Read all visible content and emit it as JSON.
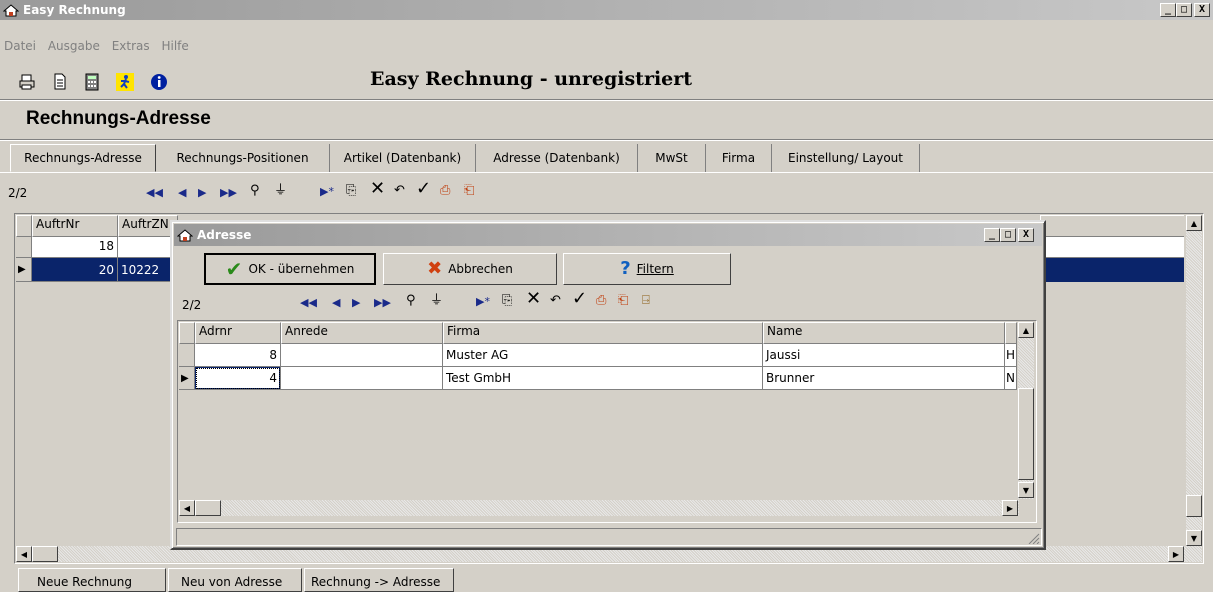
{
  "window": {
    "title": "Easy Rechnung",
    "controls": [
      "_",
      "□",
      "X"
    ]
  },
  "menu": [
    "Datei",
    "Ausgabe",
    "Extras",
    "Hilfe"
  ],
  "banner": "Easy Rechnung - unregistriert",
  "section_title": "Rechnungs-Adresse",
  "tabs": [
    "Rechnungs-Adresse",
    "Rechnungs-Positionen",
    "Artikel (Datenbank)",
    "Adresse (Datenbank)",
    "MwSt",
    "Firma",
    "Einstellung/ Layout"
  ],
  "main_nav": {
    "record_counter": "2/2"
  },
  "main_grid": {
    "columns": [
      "AuftrNr",
      "AuftrZN"
    ],
    "rows": [
      {
        "auftrnr": "18",
        "auftrzn": ""
      },
      {
        "auftrnr": "20",
        "auftrzn": "10222"
      }
    ]
  },
  "dialog": {
    "title": "Adresse",
    "ok_label": "OK - übernehmen",
    "cancel_label": "Abbrechen",
    "filter_label": "Filtern",
    "record_counter": "2/2",
    "columns": [
      "Adrnr",
      "Anrede",
      "Firma",
      "Name"
    ],
    "rows": [
      {
        "adrnr": "8",
        "anrede": "",
        "firma": "Muster AG",
        "name": "Jaussi",
        "extra": "H"
      },
      {
        "adrnr": "4",
        "anrede": "",
        "firma": "Test GmbH",
        "name": "Brunner",
        "extra": "N"
      }
    ]
  },
  "bottom_buttons": [
    "Neue Rechnung",
    "Neu von Adresse",
    "Rechnung -> Adresse"
  ],
  "colors": {
    "selection": "#0a246a",
    "face": "#d4d0c8",
    "check": "#2a8a1a",
    "cancel": "#d04010",
    "help": "#1060c0"
  }
}
